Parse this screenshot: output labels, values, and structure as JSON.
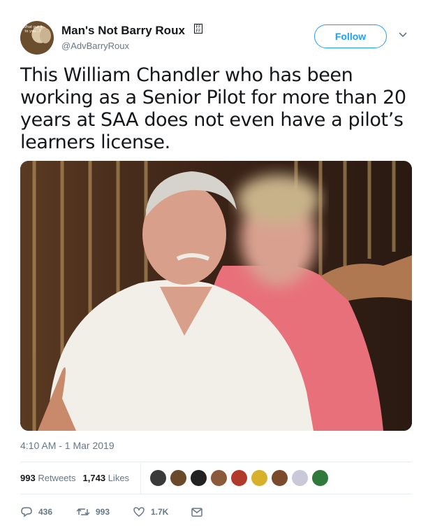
{
  "user": {
    "display_name": "Man's Not Barry Roux",
    "badge_glyph": "FF FF",
    "handle": "@AdvBarryRoux",
    "avatar_text": "What put it to you...?"
  },
  "follow_label": "Follow",
  "tweet": {
    "text": "This William Chandler who has been working as a Senior Pilot for more than 20 years at SAA does not even have a pilot’s learners license.",
    "timestamp": "4:10 AM - 1 Mar 2019"
  },
  "stats": {
    "retweets_count": "993",
    "retweets_label": "Retweets",
    "likes_count": "1,743",
    "likes_label": "Likes"
  },
  "liker_avatar_colors": [
    "#3a3a3a",
    "#6b4a2b",
    "#222222",
    "#8a5a3a",
    "#b23a2a",
    "#d8b12a",
    "#7a4a2a",
    "#c9c9d9",
    "#2f7a3a"
  ],
  "actions": {
    "reply_count": "436",
    "retweet_count": "993",
    "like_count": "1.7K"
  },
  "colors": {
    "accent": "#1da1f2",
    "text": "#14171a",
    "muted": "#657786",
    "divider": "#e6ecf0"
  }
}
